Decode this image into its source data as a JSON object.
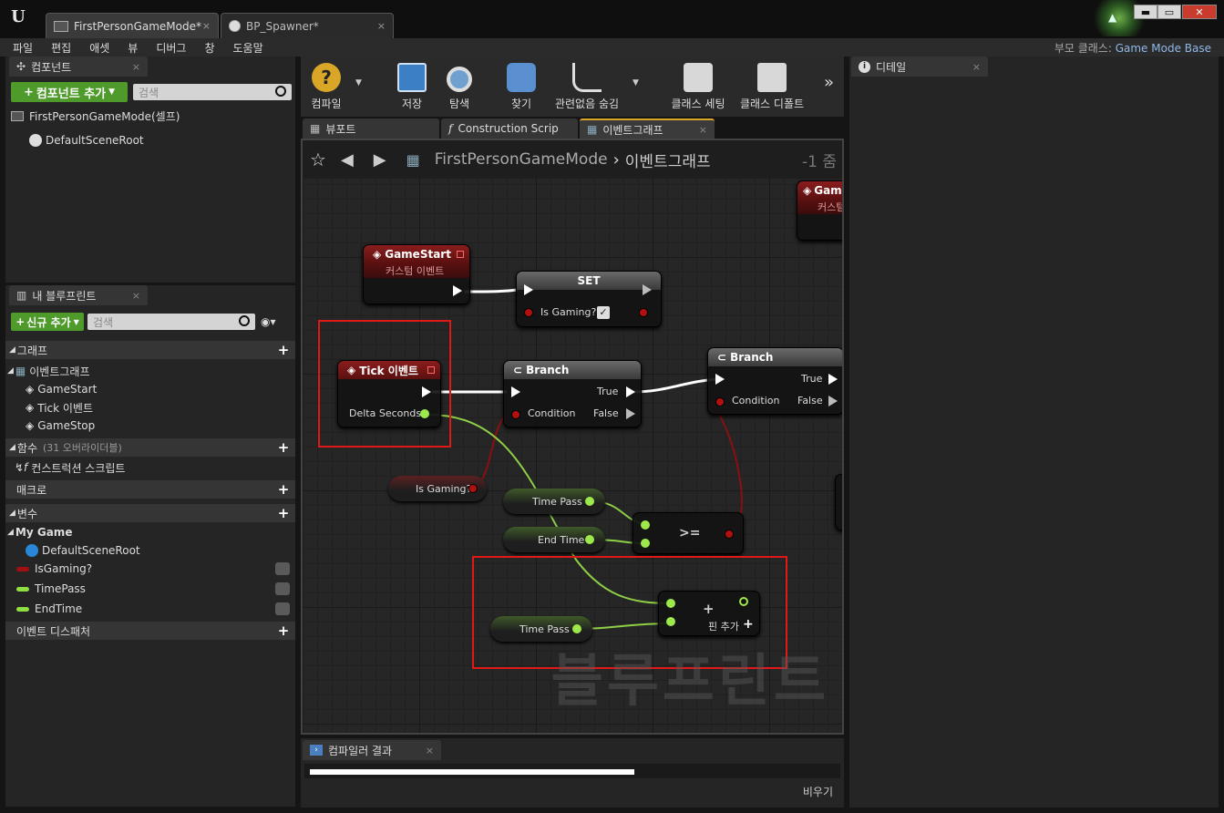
{
  "window": {
    "tabs": [
      {
        "label": "FirstPersonGameMode*",
        "close": "×"
      },
      {
        "label": "BP_Spawner*",
        "close": "×"
      }
    ],
    "buttons": {
      "minimize": "▬",
      "maximize": "▭",
      "close": "✕"
    }
  },
  "menu": [
    "파일",
    "편집",
    "애셋",
    "뷰",
    "디버그",
    "창",
    "도움말"
  ],
  "parent_class": {
    "label": "부모 클래스:",
    "value": "Game Mode Base"
  },
  "components": {
    "tab": "컴포넌트",
    "add_button": "컴포넌트 추가",
    "search_placeholder": "검색",
    "items": [
      "FirstPersonGameMode(셀프)",
      "DefaultSceneRoot"
    ]
  },
  "myblueprint": {
    "tab": "내 블루프린트",
    "new_button": "신규 추가",
    "search_placeholder": "검색",
    "graphs_header": "그래프",
    "eventgraph": "이벤트그래프",
    "events": [
      "GameStart",
      "Tick 이벤트",
      "GameStop"
    ],
    "functions_header": "함수",
    "functions_note": "(31 오버라이더블)",
    "construction": "컨스트럭션 스크립트",
    "macros_header": "매크로",
    "variables_header": "변수",
    "category": "My Game",
    "variables": [
      {
        "name": "DefaultSceneRoot",
        "color": "#2a86d6"
      },
      {
        "name": "IsGaming?",
        "color": "#a01010"
      },
      {
        "name": "TimePass",
        "color": "#8ee042"
      },
      {
        "name": "EndTime",
        "color": "#8ee042"
      }
    ],
    "dispatchers_header": "이벤트 디스패처"
  },
  "toolbar": [
    "컴파일",
    "저장",
    "탐색",
    "찾기",
    "관련없음 숨김",
    "클래스 세팅",
    "클래스 디폴트"
  ],
  "graph_tabs": [
    "뷰포트",
    "Construction Scrip",
    "이벤트그래프"
  ],
  "breadcrumb": {
    "root": "FirstPersonGameMode",
    "sep": "›",
    "current": "이벤트그래프",
    "zoom": "-1 줌"
  },
  "nodes": {
    "gamestart": {
      "title": "GameStart",
      "subtitle": "커스텀 이벤트"
    },
    "gamestop_partial": {
      "title": "Game",
      "subtitle": "커스텀"
    },
    "set": {
      "title": "SET",
      "pin": "Is Gaming?"
    },
    "tick": {
      "title": "Tick 이벤트",
      "pin": "Delta Seconds"
    },
    "branch1": {
      "title": "Branch",
      "cond": "Condition",
      "true": "True",
      "false": "False"
    },
    "branch2": {
      "title": "Branch",
      "cond": "Condition",
      "true": "True",
      "false": "False"
    },
    "isgaming": "Is Gaming?",
    "timepass1": "Time Pass",
    "endtime": "End Time",
    "compare": ">=",
    "timepass2": "Time Pass",
    "add": {
      "symbol": "+",
      "addpin": "핀 추가"
    }
  },
  "watermark": "블루프린트",
  "details": {
    "tab": "디테일"
  },
  "compiler": {
    "tab": "컴파일러 결과",
    "clear": "비우기"
  }
}
